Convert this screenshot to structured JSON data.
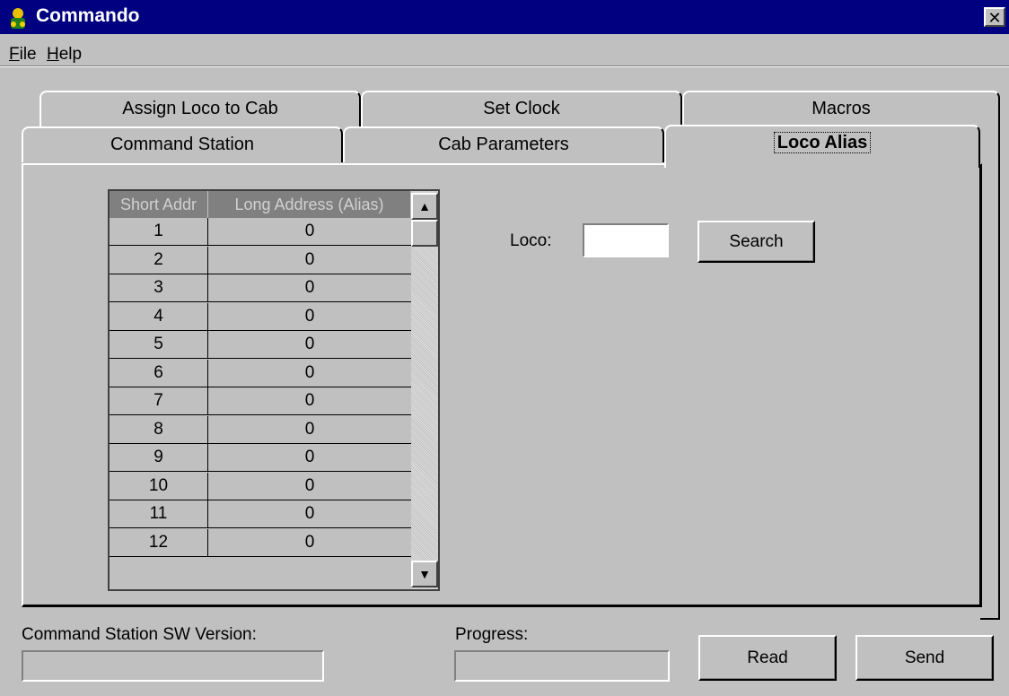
{
  "window": {
    "title": "Commando",
    "close_label": "✕"
  },
  "menu": {
    "file": "File",
    "help": "Help"
  },
  "tabs": {
    "row1": [
      "Assign Loco to Cab",
      "Set Clock",
      "Macros"
    ],
    "row2": [
      "Command Station",
      "Cab Parameters",
      "Loco Alias"
    ],
    "active": "Loco Alias"
  },
  "grid": {
    "headers": [
      "Short Addr",
      "Long Address (Alias)"
    ],
    "rows": [
      [
        "1",
        "0"
      ],
      [
        "2",
        "0"
      ],
      [
        "3",
        "0"
      ],
      [
        "4",
        "0"
      ],
      [
        "5",
        "0"
      ],
      [
        "6",
        "0"
      ],
      [
        "7",
        "0"
      ],
      [
        "8",
        "0"
      ],
      [
        "9",
        "0"
      ],
      [
        "10",
        "0"
      ],
      [
        "11",
        "0"
      ],
      [
        "12",
        "0"
      ]
    ]
  },
  "search": {
    "label": "Loco:",
    "value": "",
    "button": "Search"
  },
  "footer": {
    "version_label": "Command Station SW Version:",
    "version_value": "",
    "progress_label": "Progress:",
    "read_button": "Read",
    "send_button": "Send"
  }
}
